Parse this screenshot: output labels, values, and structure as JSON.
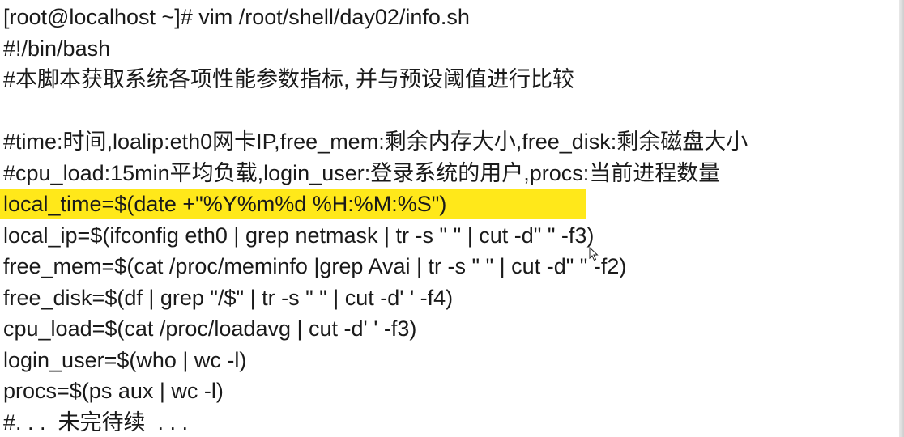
{
  "terminal": {
    "lines": [
      "[root@localhost ~]# vim /root/shell/day02/info.sh",
      "#!/bin/bash",
      "#本脚本获取系统各项性能参数指标, 并与预设阈值进行比较",
      "",
      "#time:时间,loalip:eth0网卡IP,free_mem:剩余内存大小,free_disk:剩余磁盘大小",
      "#cpu_load:15min平均负载,login_user:登录系统的用户,procs:当前进程数量",
      "local_time=$(date +\"%Y%m%d %H:%M:%S\")",
      "local_ip=$(ifconfig eth0 | grep netmask | tr -s \" \" | cut -d\" \" -f3)",
      "free_mem=$(cat /proc/meminfo |grep Avai | tr -s \" \" | cut -d\" \" -f2)",
      "free_disk=$(df | grep \"/$\" | tr -s \" \" | cut -d' ' -f4)",
      "cpu_load=$(cat /proc/loadavg | cut -d' ' -f3)",
      "login_user=$(who | wc -l)",
      "procs=$(ps aux | wc -l)",
      "#. . .  未完待续  . . ."
    ],
    "highlight_color": "#ffe81a",
    "text_color": "#1a1a1a",
    "background_color": "#ffffff"
  },
  "icons": {
    "cursor": "mouse-pointer-icon"
  }
}
